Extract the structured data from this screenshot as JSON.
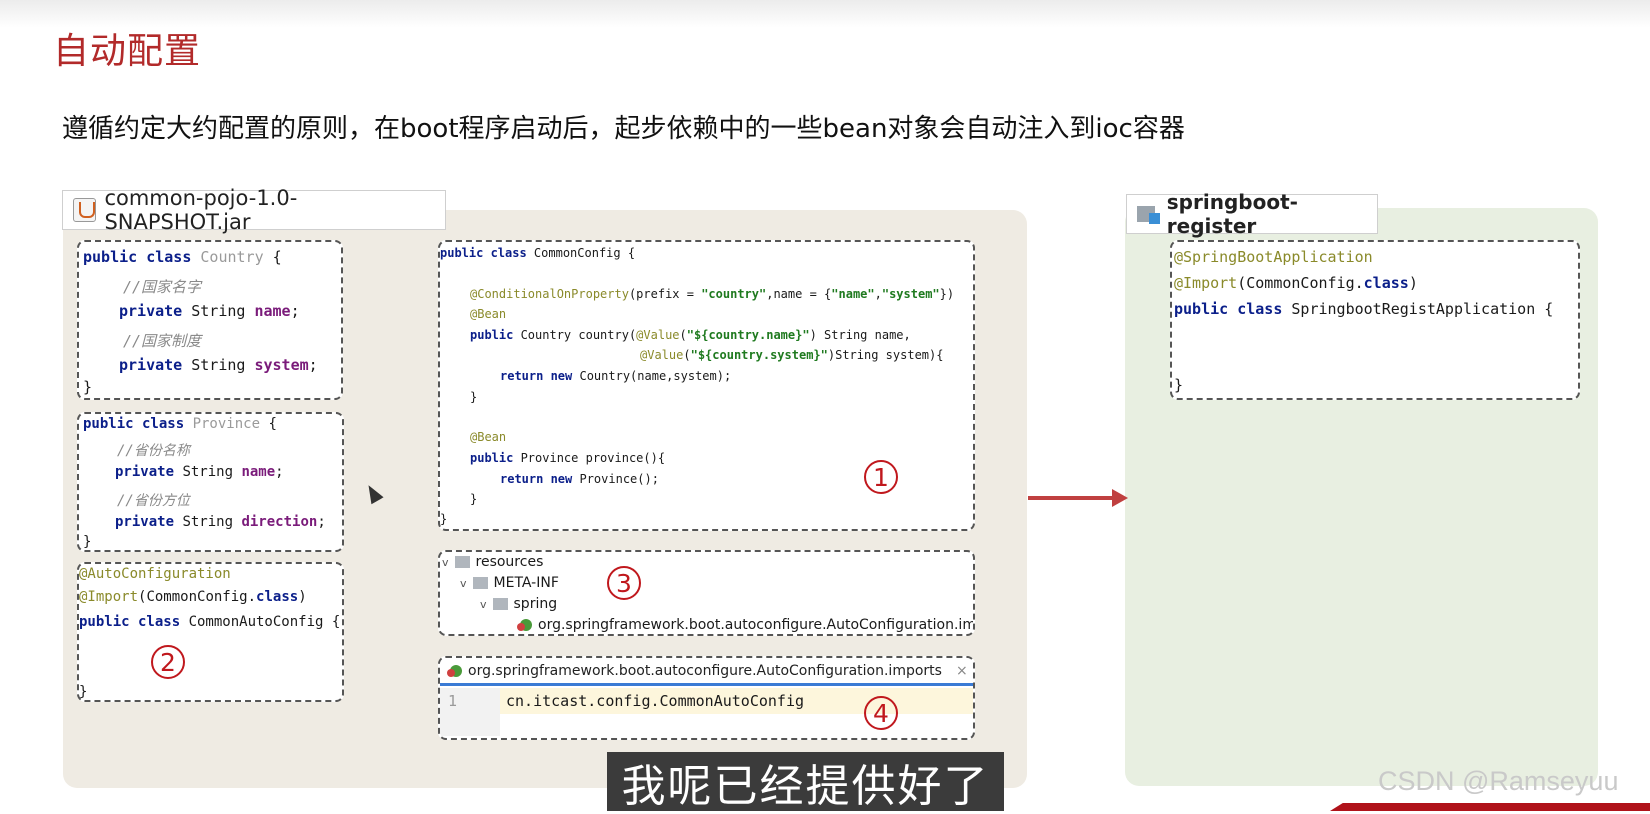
{
  "title": "自动配置",
  "subtitle": "遵循约定大约配置的原则，在boot程序启动后，起步依赖中的一些bean对象会自动注入到ioc容器",
  "jar_tag": {
    "label": "common-pojo-1.0-SNAPSHOT.jar",
    "icon": "jar-icon"
  },
  "project_tag": {
    "label": "springboot-register",
    "icon": "module-folder-icon"
  },
  "country": {
    "l1a": "public class ",
    "l1b": "Country",
    "l1c": " {",
    "l2": "//国家名字",
    "l3a": "private ",
    "l3b": "String ",
    "l3c": "name",
    "l3d": ";",
    "l4": "//国家制度",
    "l5a": "private ",
    "l5b": "String ",
    "l5c": "system",
    "l5d": ";",
    "l6": "}"
  },
  "province": {
    "l1a": "public class ",
    "l1b": "Province",
    "l1c": " {",
    "l2": "//省份名称",
    "l3a": "private ",
    "l3b": "String ",
    "l3c": "name",
    "l3d": ";",
    "l4": "//省份方位",
    "l5a": "private ",
    "l5b": "String ",
    "l5c": "direction",
    "l5d": ";",
    "l6": "}"
  },
  "autoconfig": {
    "l1": "@AutoConfiguration",
    "l2a": "@Import",
    "l2b": "(CommonConfig.",
    "l2c": "class",
    "l2d": ")",
    "l3a": "public class ",
    "l3b": "CommonAutoConfig {",
    "l4": "}"
  },
  "commonconfig": {
    "l1a": "public class ",
    "l1b": "CommonConfig {",
    "l2a": "@ConditionalOnProperty",
    "l2b": "(prefix = ",
    "l2c": "\"country\"",
    "l2d": ",name = {",
    "l2e": "\"name\"",
    "l2f": ",",
    "l2g": "\"system\"",
    "l2h": "})",
    "l3": "@Bean",
    "l4a": "public ",
    "l4b": "Country country(",
    "l4c": "@Value",
    "l4d": "(",
    "l4e": "\"${country.name}\"",
    "l4f": ") String name,",
    "l5a": "@Value",
    "l5b": "(",
    "l5c": "\"${country.system}\"",
    "l5d": ")String system){",
    "l6a": "return new ",
    "l6b": "Country(name,system);",
    "l7": "}",
    "l8": "@Bean",
    "l9a": "public ",
    "l9b": "Province province(){",
    "l10a": "return new ",
    "l10b": "Province();",
    "l11": "}",
    "l12": "}"
  },
  "tree": {
    "resources": "resources",
    "metainf": "META-INF",
    "spring": "spring",
    "file": "org.springframework.boot.autoconfigure.AutoConfiguration.imports"
  },
  "editor": {
    "tab": "org.springframework.boot.autoconfigure.AutoConfiguration.imports",
    "close": "×",
    "line_no": "1",
    "line": "cn.itcast.config.CommonAutoConfig"
  },
  "app": {
    "l1": "@SpringBootApplication",
    "l2a": "@Import",
    "l2b": "(CommonConfig.",
    "l2c": "class",
    "l2d": ")",
    "l3a": "public class ",
    "l3b": "SpringbootRegistApplication {",
    "l4": "}"
  },
  "markers": {
    "m1": "1",
    "m2": "2",
    "m3": "3",
    "m4": "4"
  },
  "caption": "我呢已经提供好了",
  "watermark": "CSDN @Ramseyuu",
  "colors": {
    "title": "#b22a2a",
    "marker": "#c0181d",
    "arrow": "#c04040"
  }
}
